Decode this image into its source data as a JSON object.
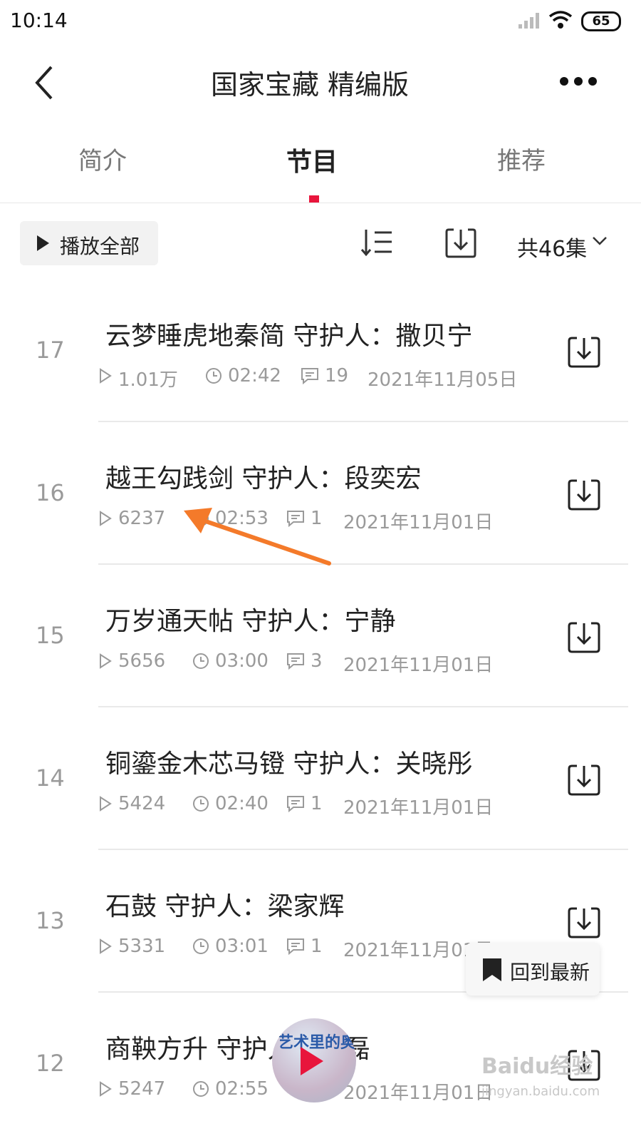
{
  "status_bar": {
    "time": "10:14",
    "battery": "65"
  },
  "nav": {
    "title": "国家宝藏 精编版"
  },
  "tabs": [
    {
      "label": "简介",
      "active": false
    },
    {
      "label": "节目",
      "active": true
    },
    {
      "label": "推荐",
      "active": false
    }
  ],
  "toolbar": {
    "play_all_label": "播放全部",
    "episode_count": "共46集"
  },
  "episodes": [
    {
      "num": "17",
      "title": "云梦睡虎地秦简 守护人：撒贝宁",
      "plays": "1.01万",
      "duration": "02:42",
      "comments": "19",
      "date": "2021年11月05日"
    },
    {
      "num": "16",
      "title": "越王勾践剑 守护人：段奕宏",
      "plays": "6237",
      "duration": "02:53",
      "comments": "1",
      "date": "2021年11月01日"
    },
    {
      "num": "15",
      "title": "万岁通天帖 守护人：宁静",
      "plays": "5656",
      "duration": "03:00",
      "comments": "3",
      "date": "2021年11月01日"
    },
    {
      "num": "14",
      "title": "铜鎏金木芯马镫 守护人：关晓彤",
      "plays": "5424",
      "duration": "02:40",
      "comments": "1",
      "date": "2021年11月01日"
    },
    {
      "num": "13",
      "title": "石鼓 守护人：梁家辉",
      "plays": "5331",
      "duration": "03:01",
      "comments": "1",
      "date": "2021年11月01日"
    },
    {
      "num": "12",
      "title": "商鞅方升 守护人：王磊",
      "plays": "5247",
      "duration": "02:55",
      "comments": "",
      "date": "2021年11月01日"
    }
  ],
  "back_to_latest_label": "回到最新",
  "mini_player": {
    "cover_text": "艺术里的奥林匹克"
  },
  "watermark": {
    "line1": "Baidu经验",
    "line2": "jingyan.baidu.com"
  },
  "colors": {
    "accent": "#e8153c",
    "annotation_arrow": "#f47a2a",
    "text_secondary": "#9a9a9a"
  }
}
